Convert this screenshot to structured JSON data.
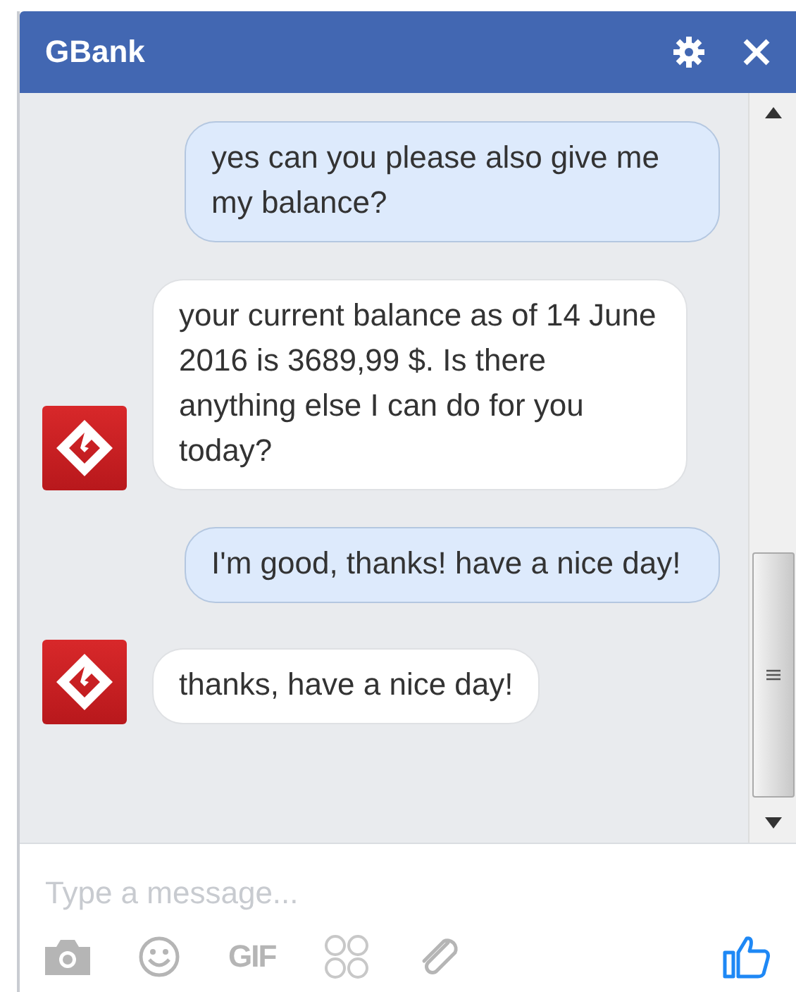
{
  "window": {
    "title": "GBank"
  },
  "messages": [
    {
      "kind": "user",
      "text": "yes can you please also give me my balance?"
    },
    {
      "kind": "bot",
      "text": "your current balance as of 14 June 2016 is 3689,99 $. Is there anything else I can do for you today?"
    },
    {
      "kind": "user",
      "text": "I'm good, thanks! have a nice day!"
    },
    {
      "kind": "bot",
      "text": "thanks, have a nice day!"
    }
  ],
  "composer": {
    "placeholder": "Type a message...",
    "gif_label": "GIF"
  }
}
